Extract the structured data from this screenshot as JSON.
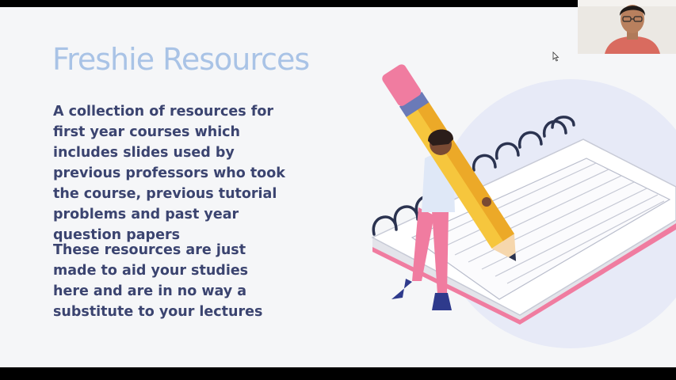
{
  "slide": {
    "title": "Freshie Resources",
    "paragraph_1": "A collection of resources for first year courses which includes slides used by previous professors who took the course, previous tutorial problems and past year question papers",
    "paragraph_2": "These resources are just made to aid your studies here and are in no way a substitute to your lectures"
  },
  "colors": {
    "title": "#a9c3e6",
    "body_text": "#3b4470",
    "slide_background": "#f5f6f8",
    "notebook_accent": "#f07ca0",
    "pencil": "#f6c63d"
  },
  "icons": [
    "mouse-cursor-icon",
    "notebook-pencil-illustration",
    "webcam-participant"
  ]
}
